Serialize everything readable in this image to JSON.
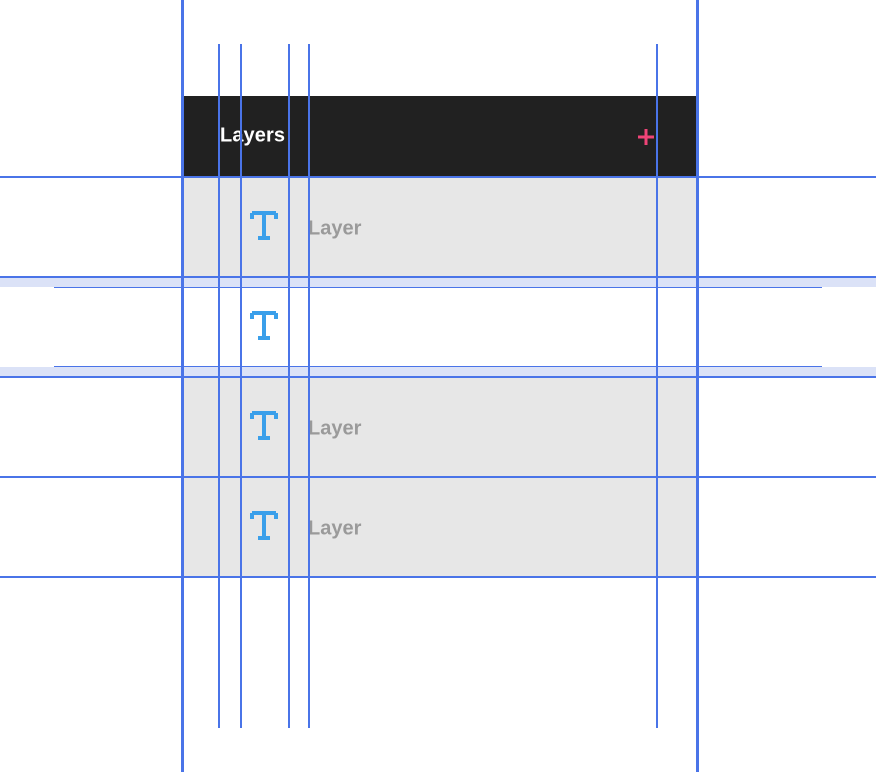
{
  "panel": {
    "title": "Layers",
    "add_icon": "plus-icon",
    "accent_color": "#ef4477",
    "header_color": "#212121"
  },
  "layers": [
    {
      "name": "Layer",
      "icon": "text-type-icon",
      "state": "default"
    },
    {
      "name": "",
      "icon": "text-type-icon",
      "state": "editing"
    },
    {
      "name": "Layer",
      "icon": "text-type-icon",
      "state": "default"
    },
    {
      "name": "Layer",
      "icon": "text-type-icon",
      "state": "default"
    }
  ],
  "colors": {
    "row_bg": "#e7e7e7",
    "icon": "#3a9fea",
    "layer_text": "#9a9a9a",
    "guide": "#4a74e8"
  }
}
